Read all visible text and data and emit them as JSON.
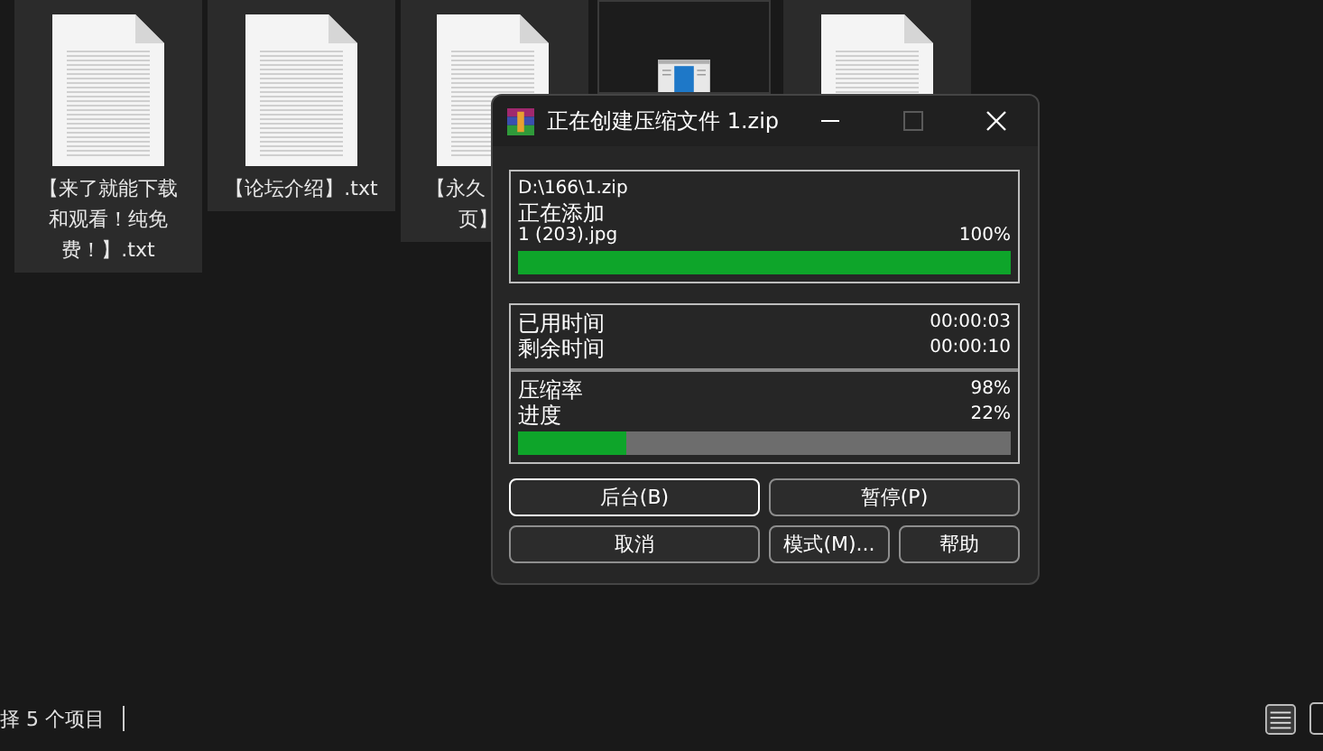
{
  "files": [
    {
      "kind": "document",
      "label_lines": [
        "【来了就能下载",
        "和观看！纯免",
        "费！】.txt"
      ]
    },
    {
      "kind": "document",
      "label_lines": [
        "【论坛介绍】.txt"
      ]
    },
    {
      "kind": "document",
      "label_lines": [
        "【永久",
        "页】"
      ]
    },
    {
      "kind": "image"
    },
    {
      "kind": "document"
    }
  ],
  "dialog": {
    "title": "正在创建压缩文件 1.zip",
    "maximize_disabled": true,
    "archive_path": "D:\\166\\1.zip",
    "action": "正在添加",
    "current_file": "1 (203).jpg",
    "file_percent": "100%",
    "file_progress": {
      "level": 1.0
    },
    "times": [
      {
        "label": "已用时间",
        "value": "00:00:03"
      },
      {
        "label": "剩余时间",
        "value": "00:00:10"
      }
    ],
    "stats": [
      {
        "label": "压缩率",
        "value": "98%"
      },
      {
        "label": "进度",
        "value": "22%"
      }
    ],
    "total_progress": {
      "level": 0.22
    },
    "buttons": [
      {
        "label": "后台(B)",
        "focused": true,
        "kind": "wide"
      },
      {
        "label": "暂停(P)",
        "focused": false,
        "kind": "wide"
      },
      {
        "label": "取消",
        "focused": false,
        "kind": "wide"
      },
      {
        "label": "模式(M)...",
        "focused": false,
        "kind": "narrow"
      },
      {
        "label": "帮助",
        "focused": false,
        "kind": "narrow"
      }
    ]
  },
  "status_bar": {
    "text": "择 5 个项目"
  }
}
